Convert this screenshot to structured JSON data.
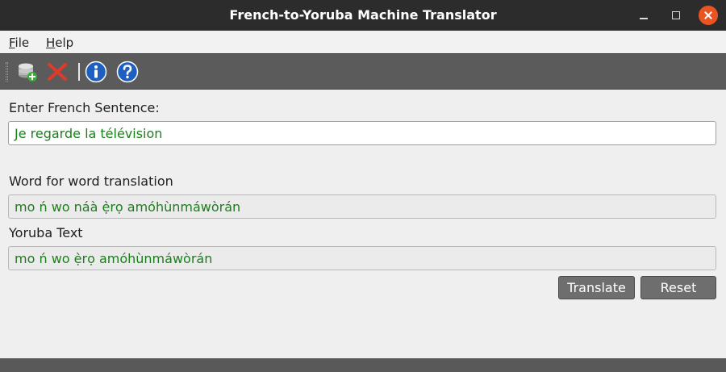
{
  "window": {
    "title": "French-to-Yoruba Machine Translator"
  },
  "menu": {
    "file_mnemonic": "F",
    "file_rest": "ile",
    "help_mnemonic": "H",
    "help_rest": "elp"
  },
  "toolbar": {
    "icons": [
      "database-add-icon",
      "delete-icon",
      "info-icon",
      "help-icon"
    ]
  },
  "form": {
    "french_label": "Enter French  Sentence:",
    "french_value": "Je regarde la télévision",
    "word_label": "Word for word translation",
    "word_value": "mo ń wo náà ẹ̀rọ amóhùnmáwòrán",
    "yoruba_label": "Yoruba Text",
    "yoruba_value": "mo ń wo ẹ̀rọ amóhùnmáwòrán"
  },
  "buttons": {
    "translate": "Translate",
    "reset": "Reset"
  },
  "colors": {
    "value_text": "#1a7f1a",
    "titlebar": "#2c2c2c",
    "close": "#e95420",
    "toolbar": "#5b5b5b"
  }
}
